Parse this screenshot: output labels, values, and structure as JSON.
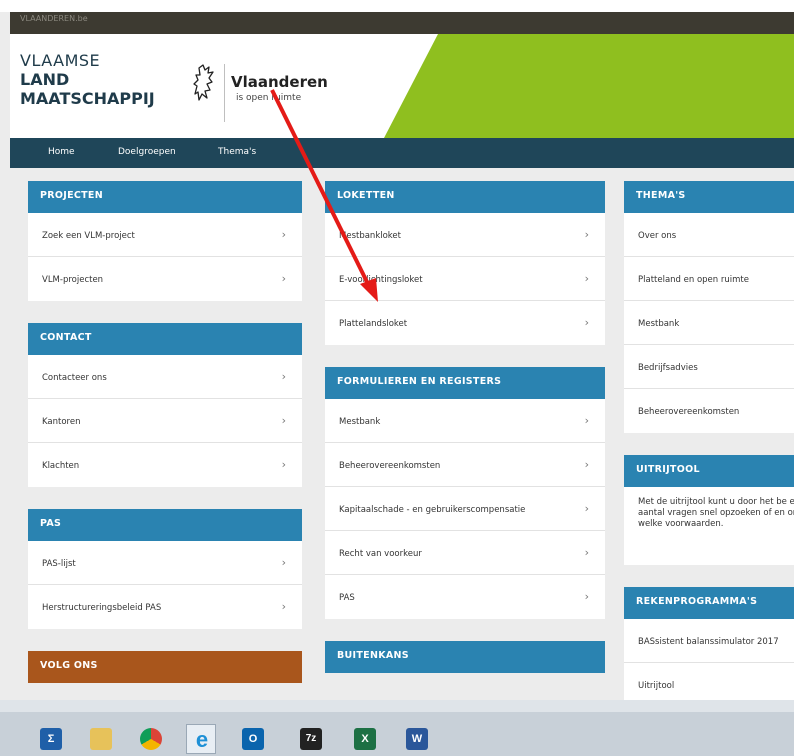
{
  "site": {
    "topbar_label": "VLAANDEREN.be",
    "brand": {
      "line1": "VLAAMSE",
      "line2": "LAND",
      "line3": "MAATSCHAPPIJ"
    },
    "partner": {
      "name": "Vlaanderen",
      "tagline": "is open ruimte"
    }
  },
  "nav": {
    "items": [
      "Home",
      "Doelgroepen",
      "Thema's"
    ]
  },
  "columns": {
    "left": {
      "projecten": {
        "title": "PROJECTEN",
        "items": [
          "Zoek een VLM-project",
          "VLM-projecten"
        ]
      },
      "contact": {
        "title": "CONTACT",
        "items": [
          "Contacteer ons",
          "Kantoren",
          "Klachten"
        ]
      },
      "pas": {
        "title": "PAS",
        "items": [
          "PAS-lijst",
          "Herstructureringsbeleid PAS"
        ]
      },
      "volg": {
        "title": "VOLG ONS"
      }
    },
    "middle": {
      "loketten": {
        "title": "LOKETTEN",
        "items": [
          "Mestbankloket",
          "E-voorlichtingsloket",
          "Plattelandsloket"
        ]
      },
      "formulieren": {
        "title": "FORMULIEREN EN REGISTERS",
        "items": [
          "Mestbank",
          "Beheerovereenkomsten",
          "Kapitaalschade - en gebruikerscompensatie",
          "Recht van voorkeur",
          "PAS"
        ]
      },
      "buitenkans": {
        "title": "BUITENKANS"
      }
    },
    "right": {
      "themas": {
        "title": "THEMA'S",
        "items": [
          "Over ons",
          "Platteland en open ruimte",
          "Mestbank",
          "Bedrijfsadvies",
          "Beheerovereenkomsten"
        ]
      },
      "uitrijtool": {
        "title": "UITRIJTOOL",
        "text": "Met de uitrijtool kunt u door het be een aantal vragen snel opzoeken of en onder welke voorwaarden."
      },
      "rekenprogrammas": {
        "title": "REKENPROGRAMMA'S",
        "items": [
          "BASsistent balanssimulator 2017",
          "Uitrijtool"
        ]
      }
    }
  },
  "chevron": "›",
  "taskbar": {
    "apps": [
      {
        "icon": "powershell-icon",
        "glyph": "Σ"
      },
      {
        "icon": "file-explorer-icon",
        "glyph": ""
      },
      {
        "icon": "chrome-icon",
        "glyph": ""
      },
      {
        "icon": "internet-explorer-icon",
        "glyph": "e"
      },
      {
        "icon": "outlook-icon",
        "glyph": "O"
      },
      {
        "icon": "7zip-icon",
        "glyph": "7z"
      },
      {
        "icon": "excel-icon",
        "glyph": "X"
      },
      {
        "icon": "word-icon",
        "glyph": "W"
      }
    ]
  },
  "colors": {
    "accent_blue": "#2a83b1",
    "nav_dark": "#1f4659",
    "brand_green": "#8fbf1f",
    "annotation_red": "#e41b17"
  }
}
